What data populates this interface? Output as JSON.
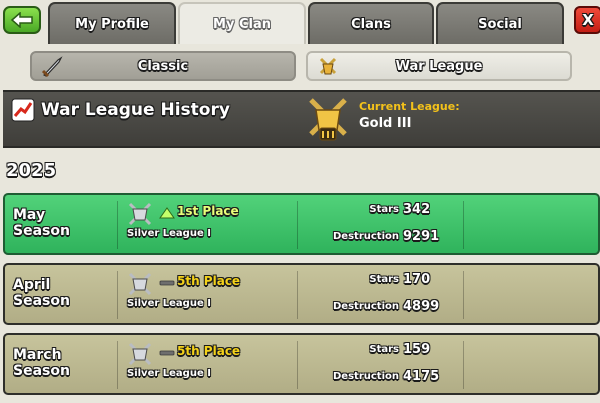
{
  "tabs": [
    "My Profile",
    "My Clan",
    "Clans",
    "Social"
  ],
  "active_tab": "My Clan",
  "close_label": "X",
  "subtabs": {
    "classic": "Classic",
    "war_league": "War League"
  },
  "header": {
    "title": "War League History",
    "current_league_label": "Current League:",
    "current_league_value": "Gold III"
  },
  "year": "2025",
  "seasons": [
    {
      "name_line1": "May",
      "name_line2": "Season",
      "place": "1st Place",
      "change": "up",
      "league": "Silver League I",
      "stars_label": "Stars",
      "stars": "342",
      "destruction_label": "Destruction",
      "destruction": "9291",
      "highlight": true
    },
    {
      "name_line1": "April",
      "name_line2": "Season",
      "place": "5th Place",
      "change": "same",
      "league": "Silver League I",
      "stars_label": "Stars",
      "stars": "170",
      "destruction_label": "Destruction",
      "destruction": "4899",
      "highlight": false
    },
    {
      "name_line1": "March",
      "name_line2": "Season",
      "place": "5th Place",
      "change": "same",
      "league": "Silver League I",
      "stars_label": "Stars",
      "stars": "159",
      "destruction_label": "Destruction",
      "destruction": "4175",
      "highlight": false
    }
  ],
  "colors": {
    "highlight_row": "#3fc46a",
    "normal_row": "#bcb891",
    "current_league_label": "#f4c21a",
    "back_button": "#5fc233",
    "close_button": "#d8281c"
  },
  "icons": {
    "back": "back-arrow-icon",
    "classic": "sword-icon",
    "war_league": "war-league-icon",
    "history": "chart-trend-icon",
    "current_league": "gold-league-badge-icon",
    "row_league": "silver-league-badge-icon",
    "up": "triangle-up-icon",
    "same": "dash-icon"
  }
}
